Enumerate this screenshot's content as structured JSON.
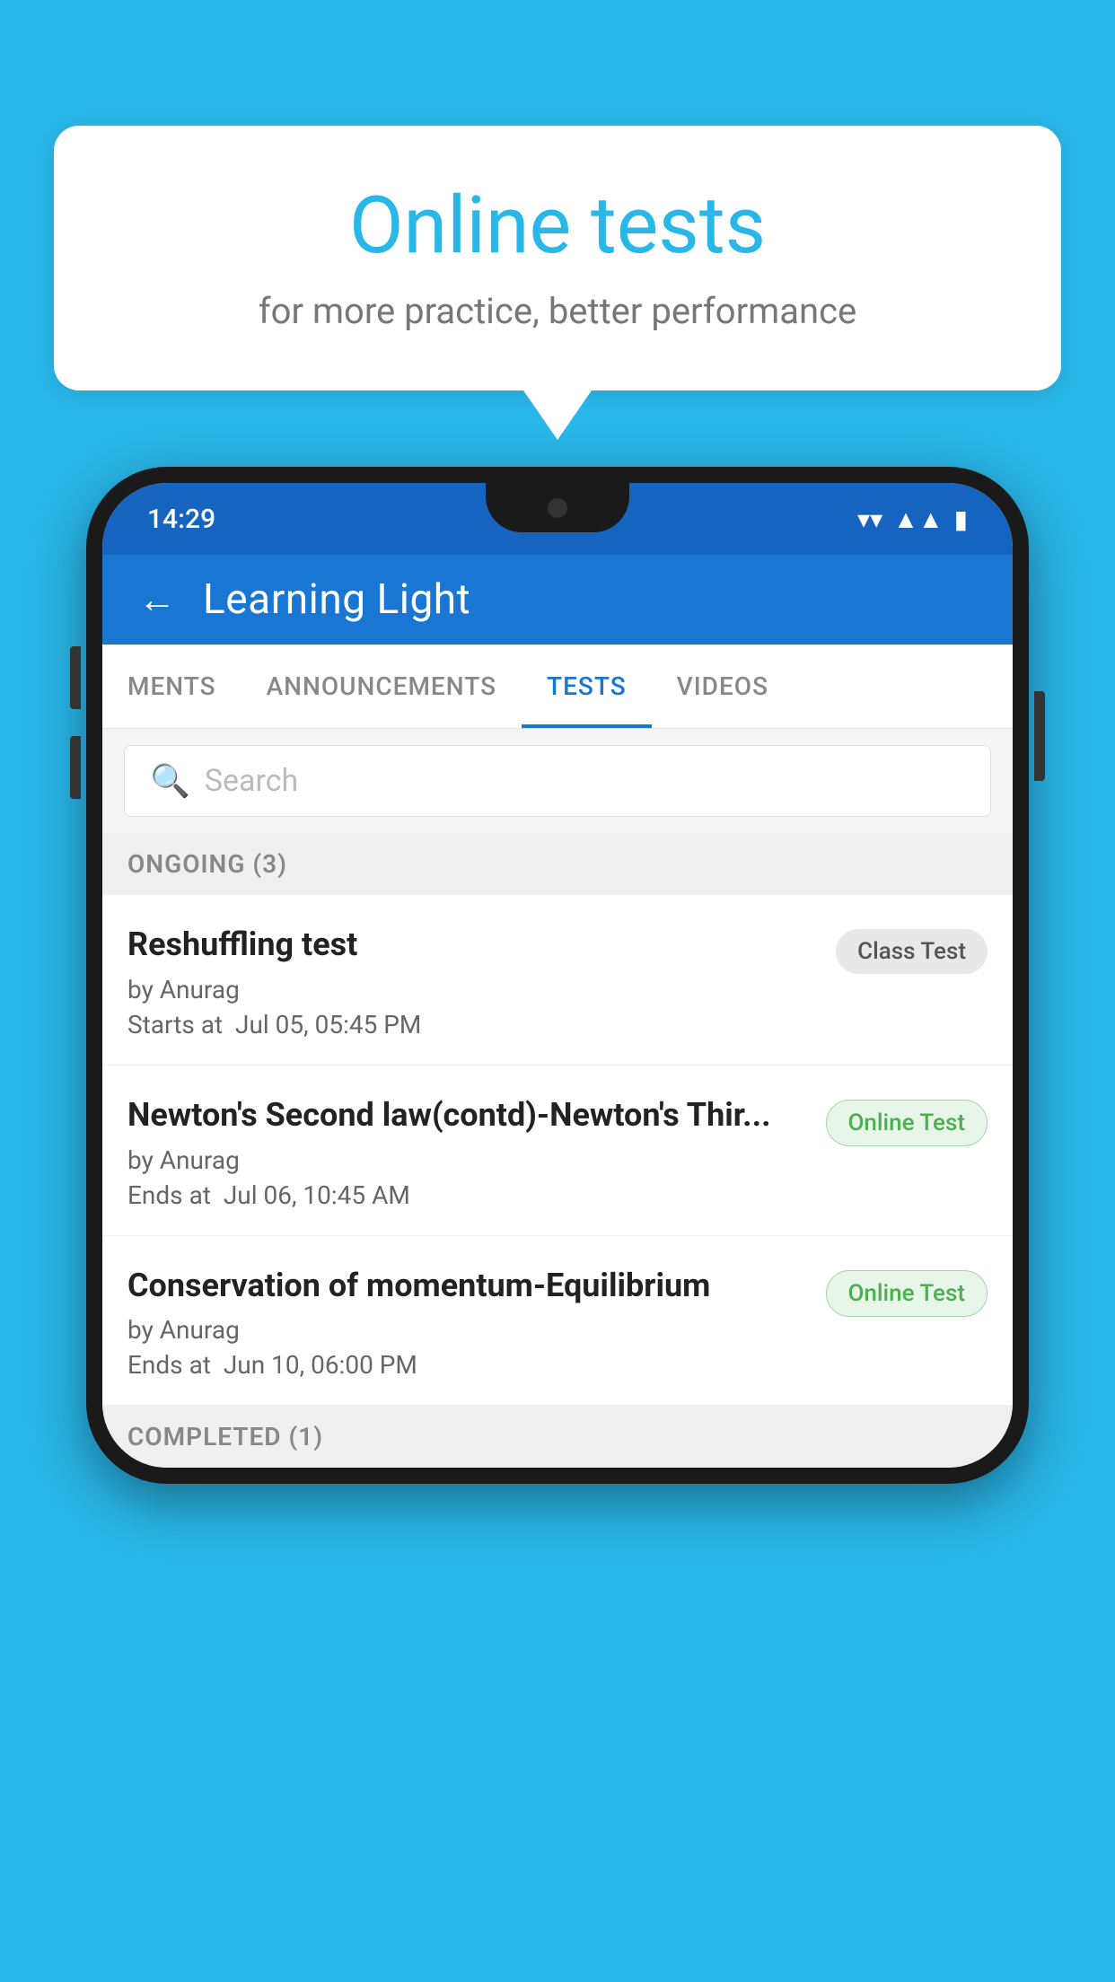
{
  "background": {
    "color": "#29b6e8"
  },
  "speech_bubble": {
    "title": "Online tests",
    "subtitle": "for more practice, better performance"
  },
  "phone": {
    "status_bar": {
      "time": "14:29",
      "icons": [
        "wifi",
        "signal",
        "battery"
      ]
    },
    "header": {
      "back_label": "←",
      "title": "Learning Light"
    },
    "tabs": [
      {
        "label": "MENTS",
        "active": false
      },
      {
        "label": "ANNOUNCEMENTS",
        "active": false
      },
      {
        "label": "TESTS",
        "active": true
      },
      {
        "label": "VIDEOS",
        "active": false
      }
    ],
    "search": {
      "placeholder": "Search"
    },
    "sections": [
      {
        "label": "ONGOING (3)",
        "tests": [
          {
            "name": "Reshuffling test",
            "author": "by Anurag",
            "date_label": "Starts at",
            "date": "Jul 05, 05:45 PM",
            "badge": "Class Test",
            "badge_type": "class"
          },
          {
            "name": "Newton's Second law(contd)-Newton's Thir...",
            "author": "by Anurag",
            "date_label": "Ends at",
            "date": "Jul 06, 10:45 AM",
            "badge": "Online Test",
            "badge_type": "online"
          },
          {
            "name": "Conservation of momentum-Equilibrium",
            "author": "by Anurag",
            "date_label": "Ends at",
            "date": "Jun 10, 06:00 PM",
            "badge": "Online Test",
            "badge_type": "online"
          }
        ]
      }
    ],
    "completed_section": {
      "label": "COMPLETED (1)"
    }
  }
}
